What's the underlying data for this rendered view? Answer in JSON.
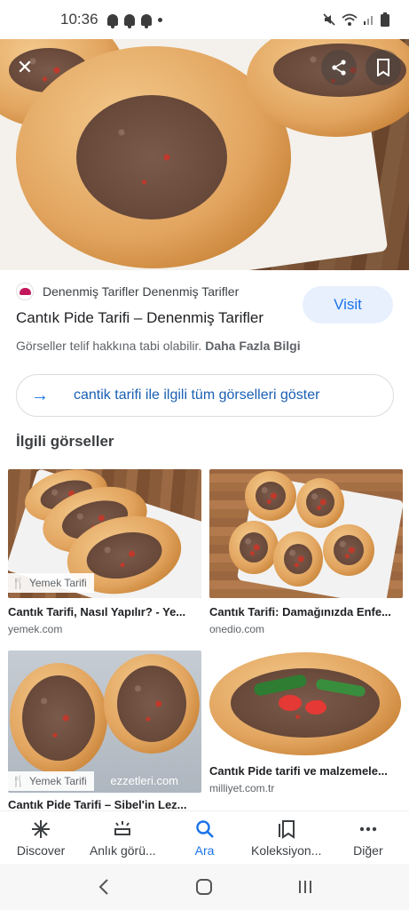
{
  "status_bar": {
    "time": "10:36"
  },
  "hero": {
    "close_icon": "close-icon",
    "share_icon": "share-icon",
    "bookmark_icon": "bookmark-icon"
  },
  "result": {
    "source": "Denenmiş Tarifler Denenmiş Tarifler",
    "title": "Cantık Pide Tarifi – Denenmiş Tarifler",
    "visit_label": "Visit",
    "copyright_text": "Görseller telif hakkına tabi olabilir.",
    "more_info": "Daha Fazla Bilgi",
    "show_all_label": "cantik tarifi ile ilgili tüm görselleri göster"
  },
  "related": {
    "heading": "İlgili görseller",
    "items": [
      {
        "title": "Cantık Tarifi, Nasıl Yapılır? - Ye...",
        "domain": "yemek.com",
        "badge": "Yemek Tarifi"
      },
      {
        "title": "Cantık Tarifi: Damağınızda Enfe...",
        "domain": "onedio.com",
        "badge": ""
      },
      {
        "title": "Cantık Pide Tarifi – Sibel'in Lez...",
        "domain": "",
        "badge": "Yemek Tarifi",
        "watermark": "ezzetleri.com"
      },
      {
        "title": "Cantık Pide tarifi ve malzemele...",
        "domain": "milliyet.com.tr",
        "badge": ""
      }
    ]
  },
  "bottom_nav": [
    {
      "label": "Discover",
      "icon": "asterisk-icon"
    },
    {
      "label": "Anlık görü...",
      "icon": "snapshot-icon"
    },
    {
      "label": "Ara",
      "icon": "search-icon"
    },
    {
      "label": "Koleksiyon...",
      "icon": "collections-icon"
    },
    {
      "label": "Diğer",
      "icon": "more-icon"
    }
  ],
  "colors": {
    "accent": "#1a73e8",
    "visit_bg": "#e8f0fe",
    "text_primary": "#202124",
    "text_secondary": "#5f6368"
  }
}
